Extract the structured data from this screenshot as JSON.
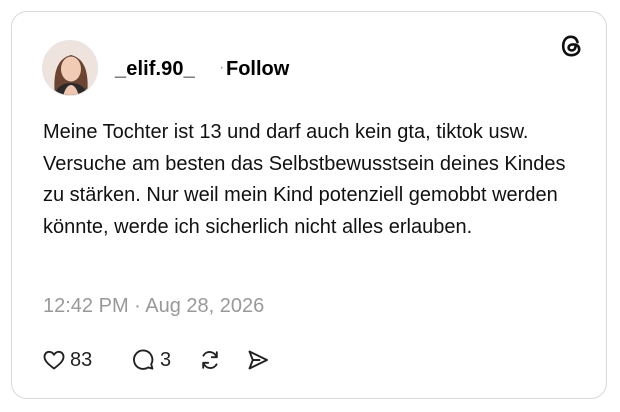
{
  "post": {
    "username": "_elif.90_",
    "separator": "·",
    "follow_label": "Follow",
    "text": "Meine Tochter ist 13 und darf auch kein gta, tiktok usw. Versuche am besten das Selbstbewusstsein deines Kindes zu stärken. Nur weil mein Kind potenziell gemobbt werden könnte, werde ich sicherlich nicht alles erlauben.",
    "timestamp": "12:42 PM · Aug 28, 2026"
  },
  "actions": {
    "likes": "83",
    "replies": "3"
  },
  "icons": {
    "logo": "threads-logo-icon",
    "like": "heart-icon",
    "reply": "comment-bubble-icon",
    "repost": "repost-icon",
    "share": "send-icon"
  }
}
